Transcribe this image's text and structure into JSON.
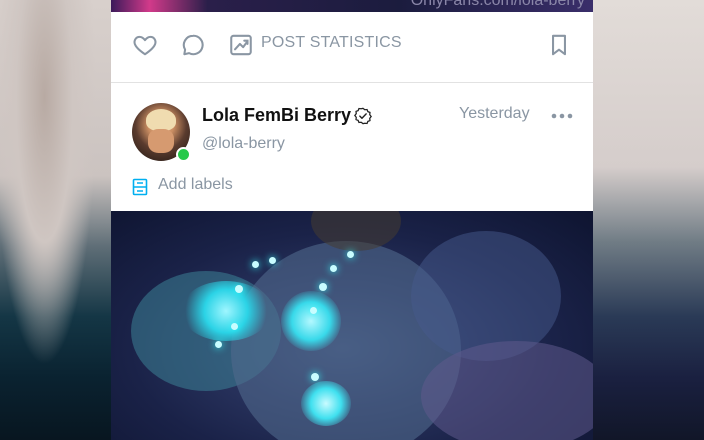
{
  "previous_post": {
    "watermark": "OnlyFans.com/lola-berry"
  },
  "actions": {
    "like_icon": "heart-icon",
    "comment_icon": "comment-icon",
    "stats_icon": "trending-chart-icon",
    "stats_label": "POST STATISTICS",
    "bookmark_icon": "bookmark-icon"
  },
  "post": {
    "author_name": "Lola FemBi Berry",
    "verified_icon": "verified-badge-icon",
    "handle": "@lola-berry",
    "timestamp": "Yesterday",
    "more_icon": "more-dots-icon",
    "labels_icon": "labels-icon",
    "add_labels": "Add labels"
  },
  "colors": {
    "accent": "#00aff0",
    "muted_text": "#8a96a3",
    "online": "#27c94b"
  }
}
